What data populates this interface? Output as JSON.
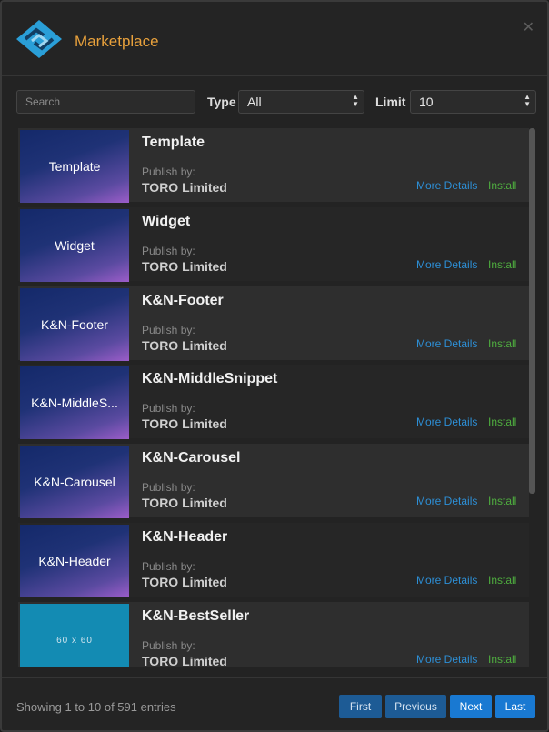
{
  "header": {
    "title": "Marketplace",
    "close_icon": "close-icon"
  },
  "filters": {
    "search_placeholder": "Search",
    "type_label": "Type",
    "type_value": "All",
    "limit_label": "Limit",
    "limit_value": "10"
  },
  "common": {
    "publish_label": "Publish by:",
    "more_details": "More Details",
    "install": "Install"
  },
  "items": [
    {
      "name": "Template",
      "thumb": "Template",
      "publisher": "TORO Limited"
    },
    {
      "name": "Widget",
      "thumb": "Widget",
      "publisher": "TORO Limited"
    },
    {
      "name": "K&N-Footer",
      "thumb": "K&N-Footer",
      "publisher": "TORO Limited"
    },
    {
      "name": "K&N-MiddleSnippet",
      "thumb": "K&N-MiddleS...",
      "publisher": "TORO Limited"
    },
    {
      "name": "K&N-Carousel",
      "thumb": "K&N-Carousel",
      "publisher": "TORO Limited"
    },
    {
      "name": "K&N-Header",
      "thumb": "K&N-Header",
      "publisher": "TORO Limited"
    },
    {
      "name": "K&N-BestSeller",
      "thumb": "60 x 60",
      "publisher": "TORO Limited"
    }
  ],
  "footer": {
    "entries": "Showing 1 to 10 of 591 entries",
    "first": "First",
    "previous": "Previous",
    "next": "Next",
    "last": "Last"
  },
  "colors": {
    "accent_title": "#e8a13c",
    "link_blue": "#2d8fd6",
    "install_green": "#4fae3f",
    "button_blue": "#1979d2"
  }
}
